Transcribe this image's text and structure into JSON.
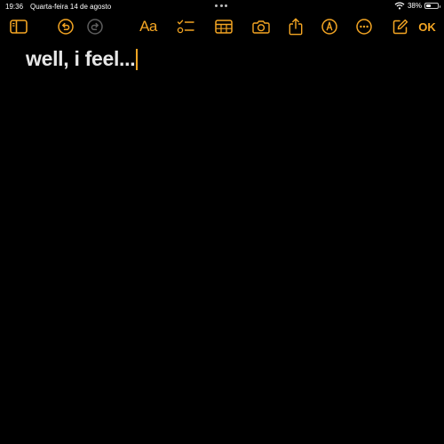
{
  "status": {
    "time": "19:36",
    "date": "Quarta-feira 14 de agosto",
    "battery_percent_label": "38%",
    "battery_level": 0.38
  },
  "toolbar": {
    "ok_label": "OK",
    "format_label": "Aa",
    "accent_color": "#f5a623",
    "icons": [
      "sidebar-icon",
      "undo-icon",
      "redo-icon",
      "format-icon",
      "checklist-icon",
      "table-icon",
      "camera-icon",
      "share-icon",
      "markup-icon",
      "more-icon",
      "compose-icon"
    ]
  },
  "note": {
    "text": "well, i feel..."
  },
  "colors": {
    "background": "#000000",
    "accent": "#f5a623",
    "text": "#e6e6e6"
  }
}
